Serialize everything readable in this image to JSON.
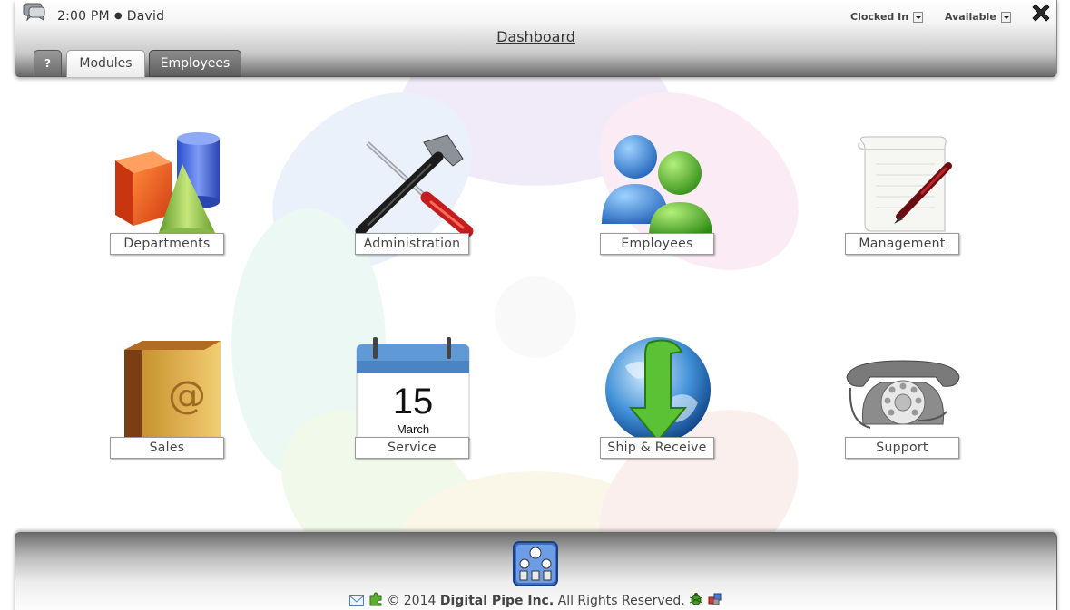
{
  "header": {
    "time": "2:00 PM",
    "user": "David",
    "page_title": "Dashboard",
    "clock_status": "Clocked In",
    "availability": "Available",
    "tabs": [
      {
        "label": "?"
      },
      {
        "label": "Modules"
      },
      {
        "label": "Employees"
      }
    ],
    "active_tab": "Modules"
  },
  "modules": [
    {
      "label": "Departments",
      "icon": "departments-shapes-icon"
    },
    {
      "label": "Administration",
      "icon": "administration-tools-icon"
    },
    {
      "label": "Employees",
      "icon": "employees-people-icon"
    },
    {
      "label": "Management",
      "icon": "management-paper-pen-icon"
    },
    {
      "label": "Sales",
      "icon": "sales-address-book-icon"
    },
    {
      "label": "Service",
      "icon": "service-calendar-icon"
    },
    {
      "label": "Ship & Receive",
      "icon": "ship-receive-globe-icon"
    },
    {
      "label": "Support",
      "icon": "support-telephone-icon"
    }
  ],
  "calendar": {
    "day": "15",
    "month": "March"
  },
  "footer": {
    "copyright_prefix": "© 2014",
    "company": "Digital Pipe Inc.",
    "rights": "All Rights Reserved."
  },
  "colors": {
    "header_top": "#ffffff",
    "header_bottom": "#6a6a6a",
    "label_border": "#9a9a9a",
    "text": "#444444"
  }
}
